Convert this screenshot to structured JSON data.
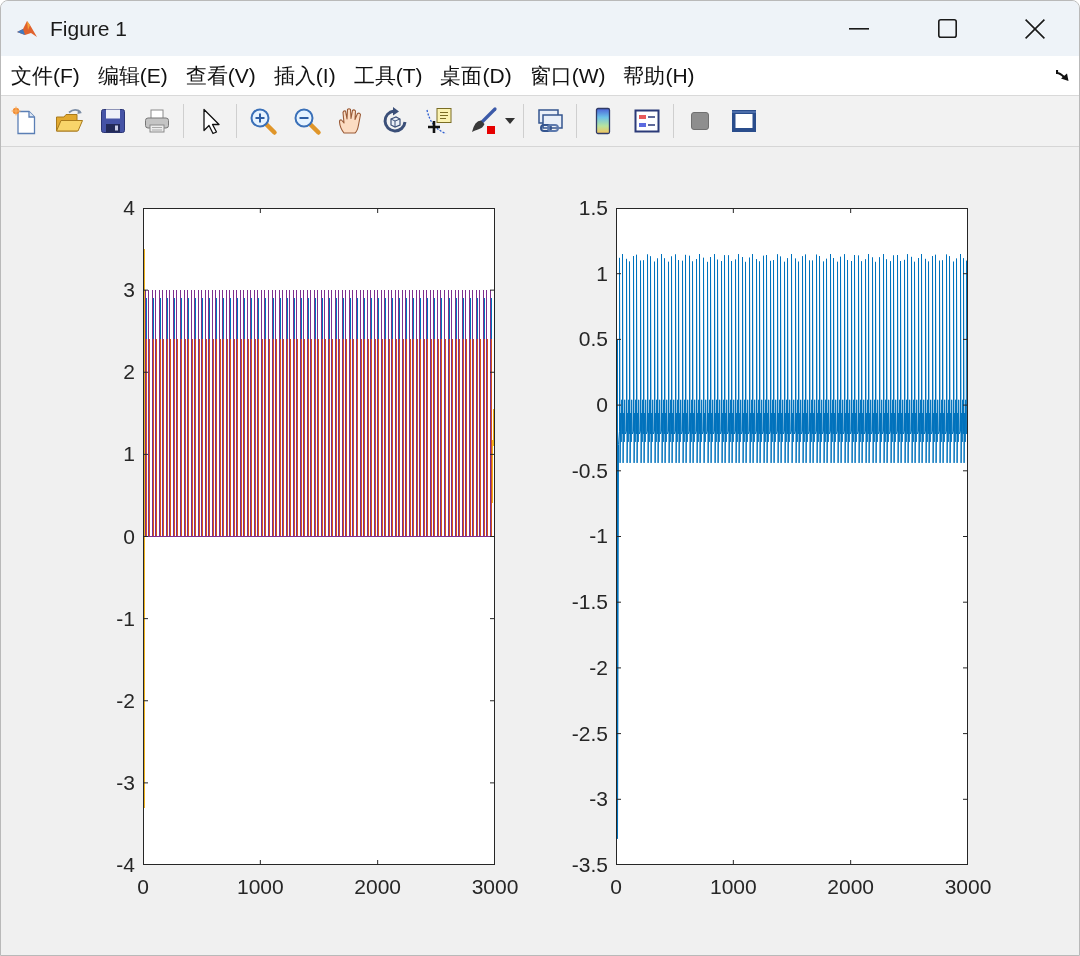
{
  "window": {
    "title": "Figure 1"
  },
  "menu": [
    "文件(F)",
    "编辑(E)",
    "查看(V)",
    "插入(I)",
    "工具(T)",
    "桌面(D)",
    "窗口(W)",
    "帮助(H)"
  ],
  "plots": [
    {
      "y_tick_labels": [
        "4",
        "3",
        "2",
        "1",
        "0",
        "-1",
        "-2",
        "-3",
        "-4"
      ],
      "x_tick_labels": [
        "0",
        "1000",
        "2000",
        "3000"
      ],
      "traces": [
        {
          "color": "#0072bd"
        },
        {
          "color": "#d95319"
        },
        {
          "color": "#edb120"
        },
        {
          "color": "#7e2f8e"
        }
      ]
    },
    {
      "y_tick_labels": [
        "1.5",
        "1",
        "0.5",
        "0",
        "-0.5",
        "-1",
        "-1.5",
        "-2",
        "-2.5",
        "-3",
        "-3.5"
      ],
      "x_tick_labels": [
        "0",
        "1000",
        "2000",
        "3000"
      ],
      "traces": [
        {
          "color": "#0072bd"
        }
      ]
    }
  ]
}
